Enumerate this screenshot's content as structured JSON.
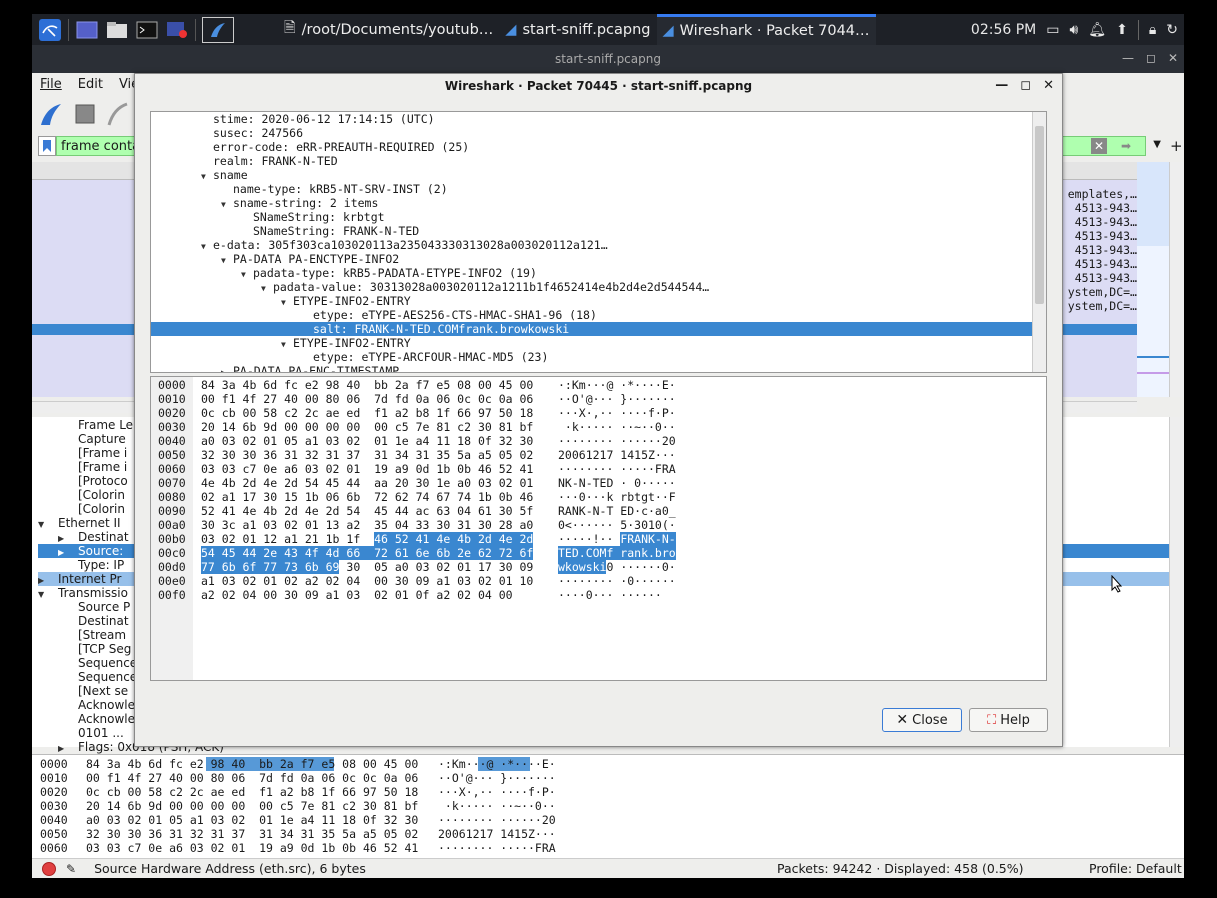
{
  "taskbar": {
    "windows": [
      {
        "label": "/root/Documents/youtub…",
        "active": false
      },
      {
        "label": "start-sniff.pcapng",
        "active": false
      },
      {
        "label": "Wireshark · Packet 7044…",
        "active": true
      }
    ],
    "clock": "02:56 PM"
  },
  "main": {
    "title": "start-sniff.pcapng",
    "menu": [
      "File",
      "Edit",
      "Vie"
    ],
    "filter_text": "frame contai",
    "packet_list_right": [
      "emplates,…",
      "4513-943…",
      "4513-943…",
      "4513-943…",
      "4513-943…",
      "4513-943…",
      "4513-943…",
      "ystem,DC=…",
      "ystem,DC=…"
    ],
    "details_left": [
      {
        "label": "Frame Le",
        "indent": 2
      },
      {
        "label": "Capture",
        "indent": 2
      },
      {
        "label": "[Frame i",
        "indent": 2
      },
      {
        "label": "[Frame i",
        "indent": 2
      },
      {
        "label": "[Protoco",
        "indent": 2
      },
      {
        "label": "[Colorin",
        "indent": 2
      },
      {
        "label": "[Colorin",
        "indent": 2
      },
      {
        "label": "Ethernet II",
        "indent": 1,
        "arrow": "down"
      },
      {
        "label": "Destinat",
        "indent": 2,
        "arrow": "right"
      },
      {
        "label": "Source:",
        "indent": 2,
        "arrow": "right",
        "selected": true
      },
      {
        "label": "Type: IP",
        "indent": 2
      },
      {
        "label": "Internet Pr",
        "indent": 1,
        "arrow": "right",
        "hover": true
      },
      {
        "label": "Transmissio",
        "indent": 1,
        "arrow": "down"
      },
      {
        "label": "Source P",
        "indent": 2
      },
      {
        "label": "Destinat",
        "indent": 2
      },
      {
        "label": "[Stream",
        "indent": 2
      },
      {
        "label": "[TCP Seg",
        "indent": 2
      },
      {
        "label": "Sequence",
        "indent": 2
      },
      {
        "label": "Sequence",
        "indent": 2
      },
      {
        "label": "[Next se",
        "indent": 2
      },
      {
        "label": "Acknowle",
        "indent": 2
      },
      {
        "label": "Acknowle",
        "indent": 2
      },
      {
        "label": "0101 ...",
        "indent": 2
      },
      {
        "label": "Flags: 0x018 (PSH, ACK)",
        "indent": 2,
        "arrow": "right"
      }
    ],
    "bottom_bytes": [
      {
        "off": "0000",
        "hex": "84 3a 4b 6d fc e2 98 40  bb 2a f7 e5 08 00 45 00",
        "ascii": "·:Km···@ ·*····E·"
      },
      {
        "off": "0010",
        "hex": "00 f1 4f 27 40 00 80 06  7d fd 0a 06 0c 0c 0a 06",
        "ascii": "··O'@··· }·······"
      },
      {
        "off": "0020",
        "hex": "0c cb 00 58 c2 2c ae ed  f1 a2 b8 1f 66 97 50 18",
        "ascii": "···X·,·· ····f·P·"
      },
      {
        "off": "0030",
        "hex": "20 14 6b 9d 00 00 00 00  00 c5 7e 81 c2 30 81 bf",
        "ascii": " ·k····· ··~··0··"
      },
      {
        "off": "0040",
        "hex": "a0 03 02 01 05 a1 03 02  01 1e a4 11 18 0f 32 30",
        "ascii": "········ ······20"
      },
      {
        "off": "0050",
        "hex": "32 30 30 36 31 32 31 37  31 34 31 35 5a a5 05 02",
        "ascii": "20061217 1415Z···"
      },
      {
        "off": "0060",
        "hex": "03 03 c7 0e a6 03 02 01  19 a9 0d 1b 0b 46 52 41",
        "ascii": "········ ·····FRA"
      }
    ],
    "status": {
      "field": "Source Hardware Address (eth.src), 6 bytes",
      "packets": "Packets: 94242 · Displayed: 458 (0.5%)",
      "profile": "Profile: Default"
    }
  },
  "dialog": {
    "title": "Wireshark · Packet 70445 · start-sniff.pcapng",
    "tree": [
      {
        "text": "stime: 2020-06-12 17:14:15 (UTC)",
        "indent": 3
      },
      {
        "text": "susec: 247566",
        "indent": 3
      },
      {
        "text": "error-code: eRR-PREAUTH-REQUIRED (25)",
        "indent": 3
      },
      {
        "text": "realm: FRANK-N-TED",
        "indent": 3
      },
      {
        "text": "sname",
        "indent": 3,
        "arrow": "down"
      },
      {
        "text": "name-type: kRB5-NT-SRV-INST (2)",
        "indent": 4
      },
      {
        "text": "sname-string: 2 items",
        "indent": 4,
        "arrow": "down"
      },
      {
        "text": "SNameString: krbtgt",
        "indent": 5
      },
      {
        "text": "SNameString: FRANK-N-TED",
        "indent": 5
      },
      {
        "text": "e-data: 305f303ca103020113a235043330313028a003020112a121…",
        "indent": 3,
        "arrow": "down"
      },
      {
        "text": "PA-DATA PA-ENCTYPE-INFO2",
        "indent": 4,
        "arrow": "down"
      },
      {
        "text": "padata-type: kRB5-PADATA-ETYPE-INFO2 (19)",
        "indent": 5,
        "arrow": "down"
      },
      {
        "text": "padata-value: 30313028a003020112a1211b1f4652414e4b2d4e2d544544…",
        "indent": 6,
        "arrow": "down"
      },
      {
        "text": "ETYPE-INFO2-ENTRY",
        "indent": 7,
        "arrow": "down"
      },
      {
        "text": "etype: eTYPE-AES256-CTS-HMAC-SHA1-96 (18)",
        "indent": 8
      },
      {
        "text": "salt: FRANK-N-TED.COMfrank.browkowski",
        "indent": 8,
        "selected": true
      },
      {
        "text": "ETYPE-INFO2-ENTRY",
        "indent": 7,
        "arrow": "down"
      },
      {
        "text": "etype: eTYPE-ARCFOUR-HMAC-MD5 (23)",
        "indent": 8
      },
      {
        "text": "PA-DATA PA-ENC-TIMESTAMP",
        "indent": 4,
        "arrow": "right"
      }
    ],
    "bytes": [
      {
        "off": "0000",
        "hex": "84 3a 4b 6d fc e2 98 40  bb 2a f7 e5 08 00 45 00",
        "ascii": "·:Km···@ ·*····E·"
      },
      {
        "off": "0010",
        "hex": "00 f1 4f 27 40 00 80 06  7d fd 0a 06 0c 0c 0a 06",
        "ascii": "··O'@··· }·······"
      },
      {
        "off": "0020",
        "hex": "0c cb 00 58 c2 2c ae ed  f1 a2 b8 1f 66 97 50 18",
        "ascii": "···X·,·· ····f·P·"
      },
      {
        "off": "0030",
        "hex": "20 14 6b 9d 00 00 00 00  00 c5 7e 81 c2 30 81 bf",
        "ascii": " ·k····· ··~··0··"
      },
      {
        "off": "0040",
        "hex": "a0 03 02 01 05 a1 03 02  01 1e a4 11 18 0f 32 30",
        "ascii": "········ ······20"
      },
      {
        "off": "0050",
        "hex": "32 30 30 36 31 32 31 37  31 34 31 35 5a a5 05 02",
        "ascii": "20061217 1415Z···"
      },
      {
        "off": "0060",
        "hex": "03 03 c7 0e a6 03 02 01  19 a9 0d 1b 0b 46 52 41",
        "ascii": "········ ·····FRA"
      },
      {
        "off": "0070",
        "hex": "4e 4b 2d 4e 2d 54 45 44  aa 20 30 1e a0 03 02 01",
        "ascii": "NK-N-TED · 0·····"
      },
      {
        "off": "0080",
        "hex": "02 a1 17 30 15 1b 06 6b  72 62 74 67 74 1b 0b 46",
        "ascii": "···0···k rbtgt··F"
      },
      {
        "off": "0090",
        "hex": "52 41 4e 4b 2d 4e 2d 54  45 44 ac 63 04 61 30 5f",
        "ascii": "RANK-N-T ED·c·a0_"
      },
      {
        "off": "00a0",
        "hex": "30 3c a1 03 02 01 13 a2  35 04 33 30 31 30 28 a0",
        "ascii": "0<······ 5·3010(·"
      },
      {
        "off": "00b0",
        "hex_a": "03 02 01 12 a1 21 1b 1f  ",
        "hex_b": "46 52 41 4e 4b 2d 4e 2d",
        "hex_c": "",
        "ascii_a": "·····!·· ",
        "ascii_b": "FRANK-N-",
        "ascii_c": ""
      },
      {
        "off": "00c0",
        "hex_a": "",
        "hex_b": "54 45 44 2e 43 4f 4d 66  72 61 6e 6b 2e 62 72 6f",
        "hex_c": "",
        "ascii_a": "",
        "ascii_b": "TED.COMf rank.bro",
        "ascii_c": ""
      },
      {
        "off": "00d0",
        "hex_a": "",
        "hex_b": "77 6b 6f 77 73 6b 69",
        "hex_c": " 30  05 a0 03 02 01 17 30 09",
        "ascii_a": "",
        "ascii_b": "wkowski",
        "ascii_c": "0 ······0·"
      },
      {
        "off": "00e0",
        "hex": "a1 03 02 01 02 a2 02 04  00 30 09 a1 03 02 01 10",
        "ascii": "········ ·0······"
      },
      {
        "off": "00f0",
        "hex": "a2 02 04 00 30 09 a1 03  02 01 0f a2 02 04 00",
        "ascii": "····0··· ······"
      }
    ],
    "close_label": "Close",
    "help_label": "Help"
  }
}
